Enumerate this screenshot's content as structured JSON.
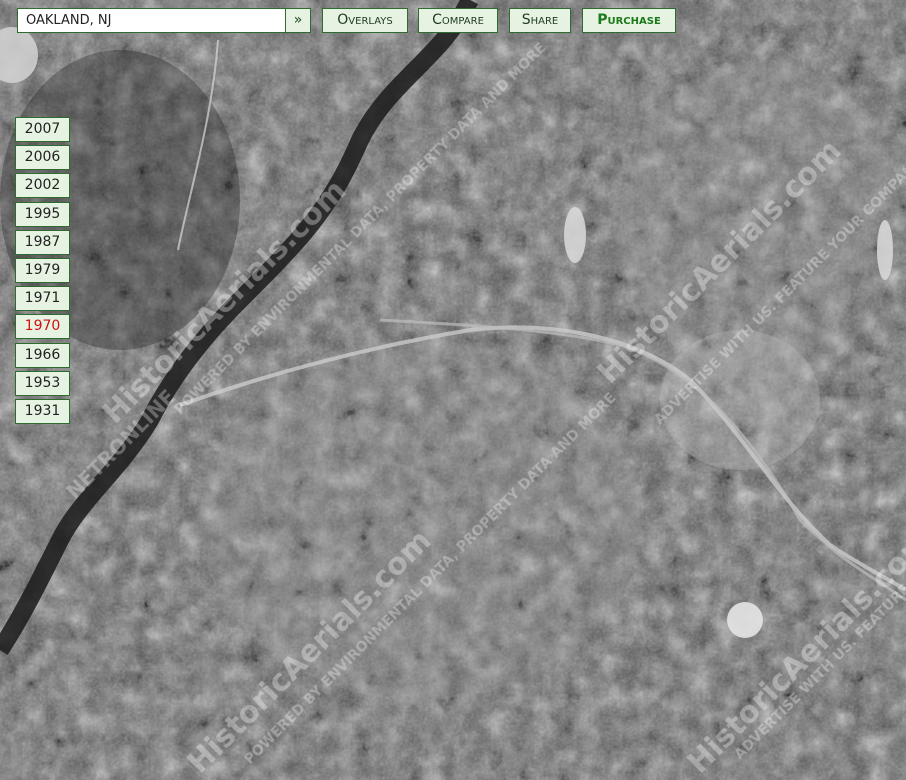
{
  "search": {
    "value": "OAKLAND, NJ",
    "go_label": "»"
  },
  "toolbar": {
    "overlays_label": "Overlays",
    "compare_label": "Compare",
    "share_label": "Share",
    "purchase_label": "Purchase"
  },
  "years": [
    "2007",
    "2006",
    "2002",
    "1995",
    "1987",
    "1979",
    "1971",
    "1970",
    "1966",
    "1953",
    "1931"
  ],
  "selected_year": "1970",
  "watermark": "HistoricAerials.com",
  "watermark_lines": [
    "POWERED BY ENVIRONMENTAL DATA, PROPERTY DATA AND MORE",
    "NETRONLINE",
    "ADVERTISE WITH US. FEATURE YOUR COMPANY HERE AS A WATERMARK"
  ],
  "colors": {
    "button_bg": "#e7f3e2",
    "button_border": "#2e6b2e",
    "purchase_text": "#1b7a1b",
    "selected_year_text": "#d01010"
  }
}
